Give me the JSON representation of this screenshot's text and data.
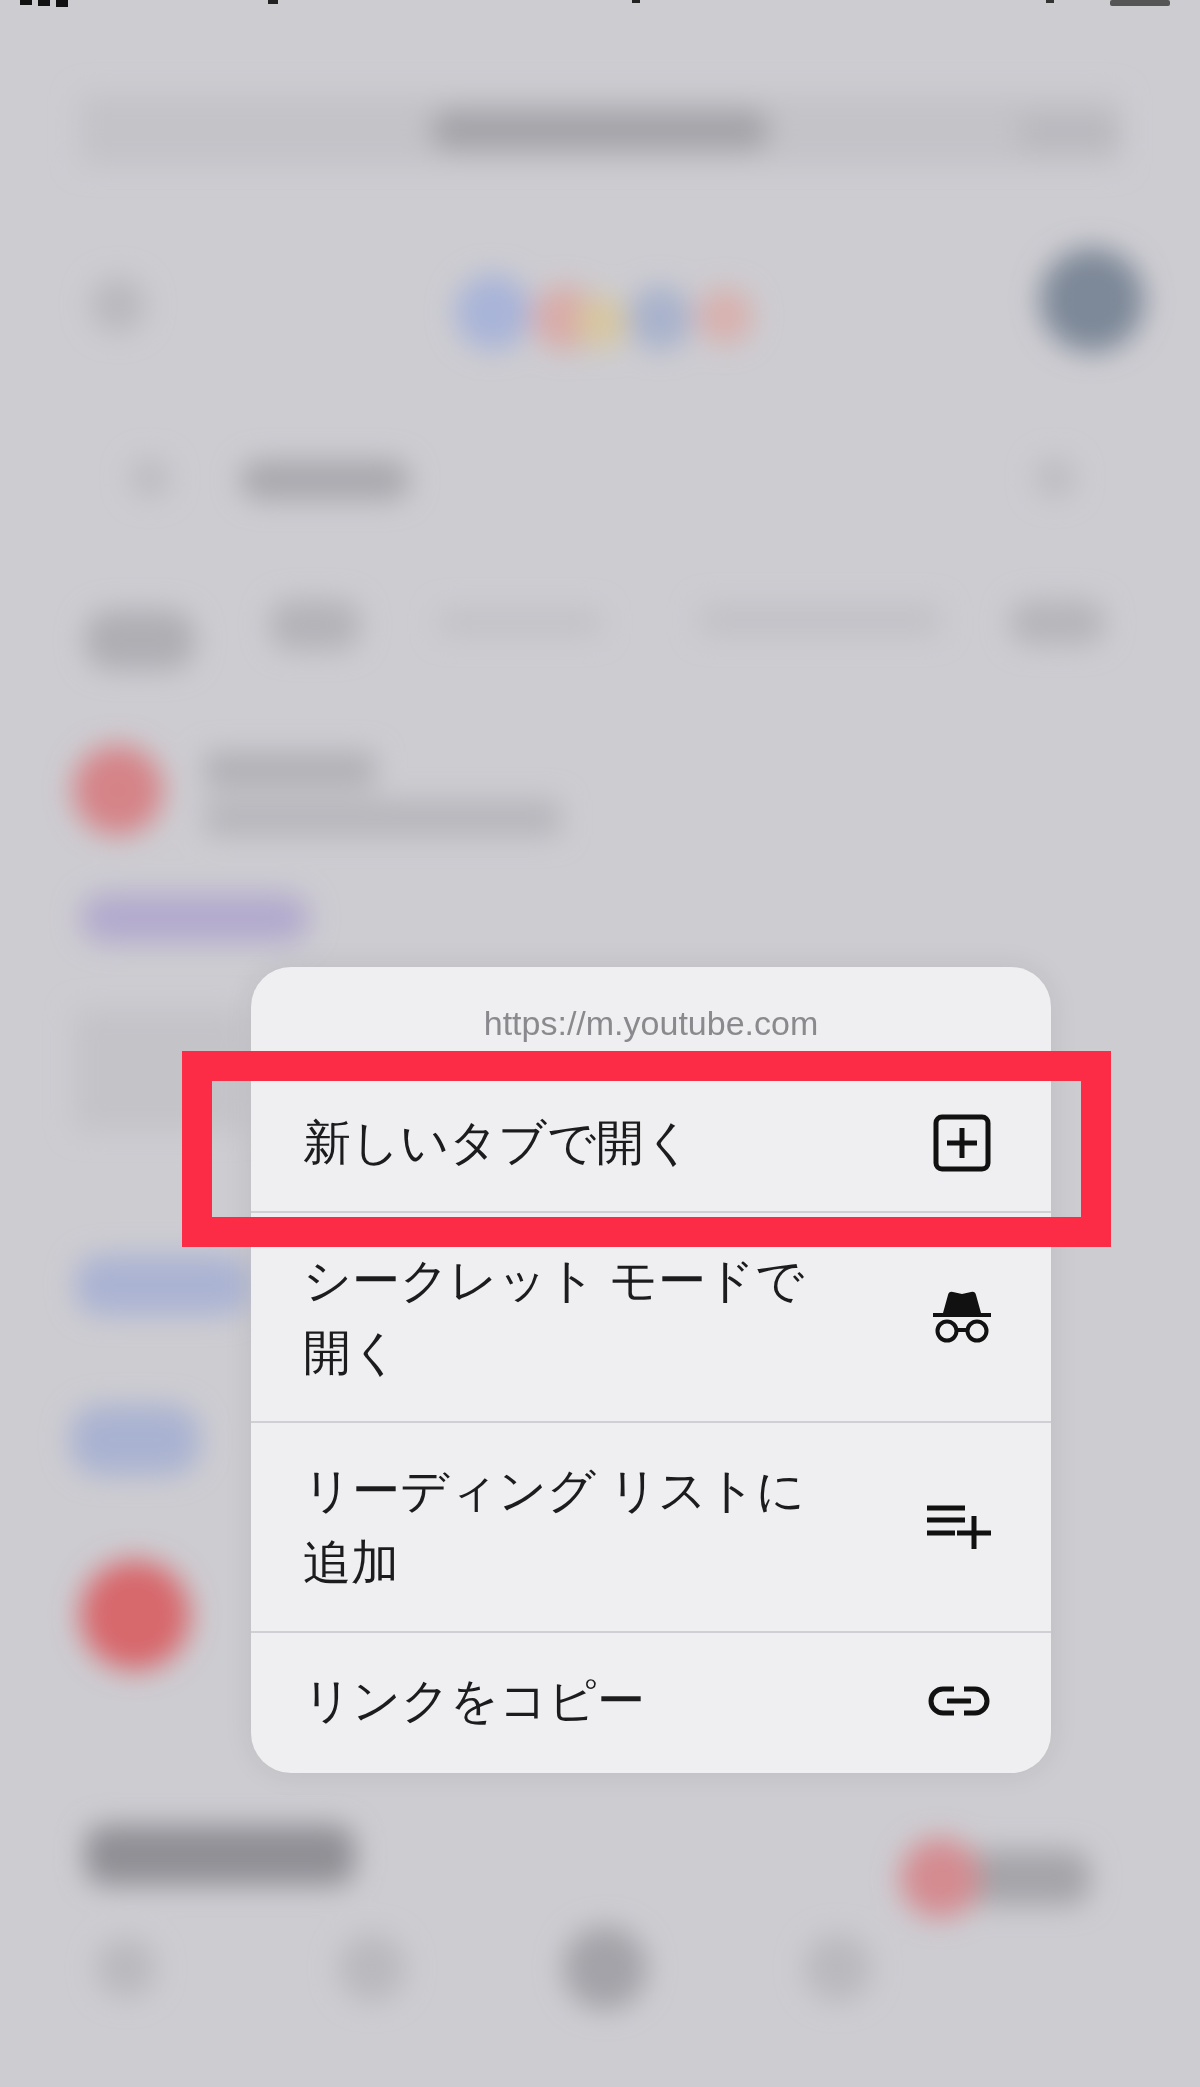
{
  "context_menu": {
    "url": "https://m.youtube.com",
    "items": [
      {
        "label": "新しいタブで開く",
        "highlighted": true
      },
      {
        "label": "シークレット モードで開く",
        "highlighted": false
      },
      {
        "label": "リーディング リストに追加",
        "highlighted": false
      },
      {
        "label": "リンクをコピー",
        "highlighted": false
      }
    ]
  }
}
